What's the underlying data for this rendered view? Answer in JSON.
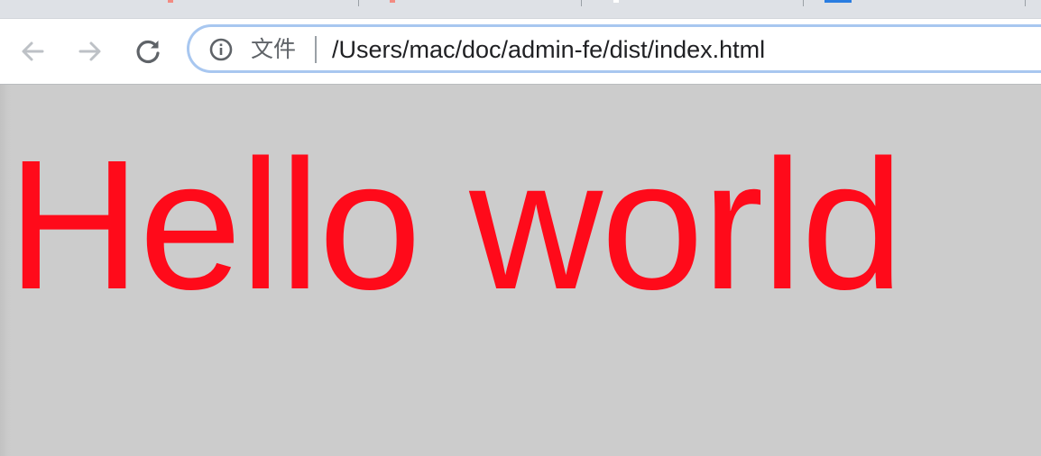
{
  "browser": {
    "address_bar": {
      "scheme_label": "文件",
      "url": "/Users/mac/doc/admin-fe/dist/index.html"
    }
  },
  "page": {
    "heading": "Hello world",
    "heading_color": "#ff0a1a",
    "background_color": "#cccccc"
  },
  "icons": {
    "back": "arrow-left-icon",
    "forward": "arrow-right-icon",
    "reload": "reload-icon",
    "site_info": "info-icon"
  }
}
